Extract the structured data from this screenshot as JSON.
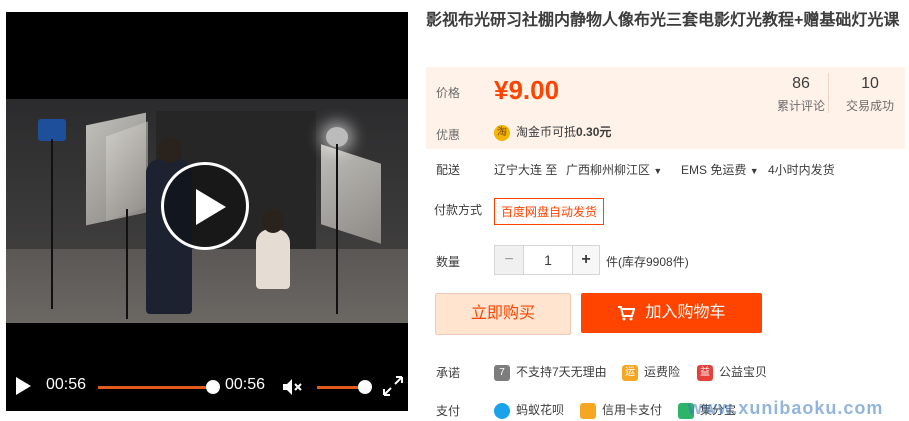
{
  "video": {
    "current_time": "00:56",
    "duration": "00:56",
    "progress": 1.0,
    "volume": 0.85
  },
  "product": {
    "title": "影视布光研习社棚内静物人像布光三套电影灯光教程+赠基础灯光课"
  },
  "price": {
    "label": "价格",
    "value": "¥9.00",
    "reviews_count": "86",
    "reviews_label": "累计评论",
    "sales_count": "10",
    "sales_label": "交易成功"
  },
  "promo": {
    "label": "优惠",
    "icon_char": "淘",
    "text_prefix": "淘金币可抵",
    "text_amount": "0.30元"
  },
  "shipping": {
    "label": "配送",
    "from": "辽宁大连 至",
    "to": "广西柳州柳江区",
    "method": "EMS 免运费",
    "dispatch": "4小时内发货"
  },
  "payment_method": {
    "label": "付款方式",
    "option": "百度网盘自动发货"
  },
  "quantity": {
    "label": "数量",
    "minus": "−",
    "value": "1",
    "plus": "+",
    "stock": "件(库存9908件)"
  },
  "buttons": {
    "buy_now": "立即购买",
    "add_cart": "加入购物车"
  },
  "promise": {
    "label": "承诺",
    "items": [
      "不支持7天无理由",
      "运费险",
      "公益宝贝"
    ],
    "icon_chars": [
      "7",
      "运",
      "益"
    ]
  },
  "pay": {
    "label": "支付",
    "items": [
      "蚂蚁花呗",
      "信用卡支付",
      "集分宝"
    ]
  },
  "watermark": "www.xunibaoku.com",
  "colors": {
    "accent": "#ff4400",
    "price_bg": "#fff2e8",
    "buy_now_bg": "#ffe4d0",
    "cart_bg": "#ff4400"
  }
}
